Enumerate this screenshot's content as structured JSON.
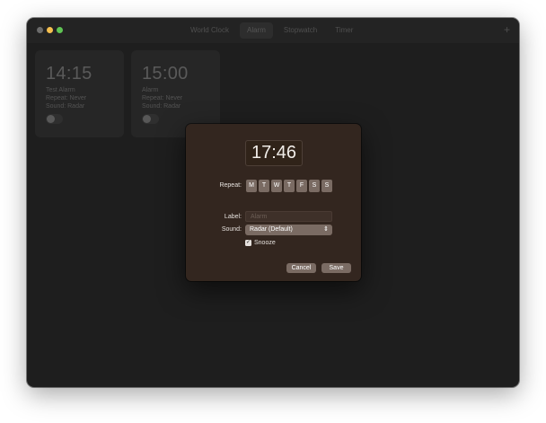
{
  "window": {
    "tabs": [
      {
        "label": "World Clock",
        "active": false
      },
      {
        "label": "Alarm",
        "active": true
      },
      {
        "label": "Stopwatch",
        "active": false
      },
      {
        "label": "Timer",
        "active": false
      }
    ],
    "add_icon": "+"
  },
  "alarms": [
    {
      "time": "14:15",
      "label": "Test Alarm",
      "repeat": "Repeat: Never",
      "sound": "Sound: Radar",
      "enabled": false
    },
    {
      "time": "15:00",
      "label": "Alarm",
      "repeat": "Repeat: Never",
      "sound": "Sound: Radar",
      "enabled": false
    }
  ],
  "dialog": {
    "time": "17:46",
    "repeat_label": "Repeat:",
    "days": [
      "M",
      "T",
      "W",
      "T",
      "F",
      "S",
      "S"
    ],
    "label_label": "Label:",
    "label_placeholder": "Alarm",
    "sound_label": "Sound:",
    "sound_value": "Radar (Default)",
    "snooze_label": "Snooze",
    "snooze_checked": true,
    "cancel_label": "Cancel",
    "save_label": "Save"
  },
  "colors": {
    "window_bg": "#1e1e1e",
    "dialog_bg": "#33261f",
    "control_bg": "#7a6b63",
    "traffic_close": "#6b6b6b",
    "traffic_min": "#f5bf4f",
    "traffic_max": "#5fc454"
  }
}
